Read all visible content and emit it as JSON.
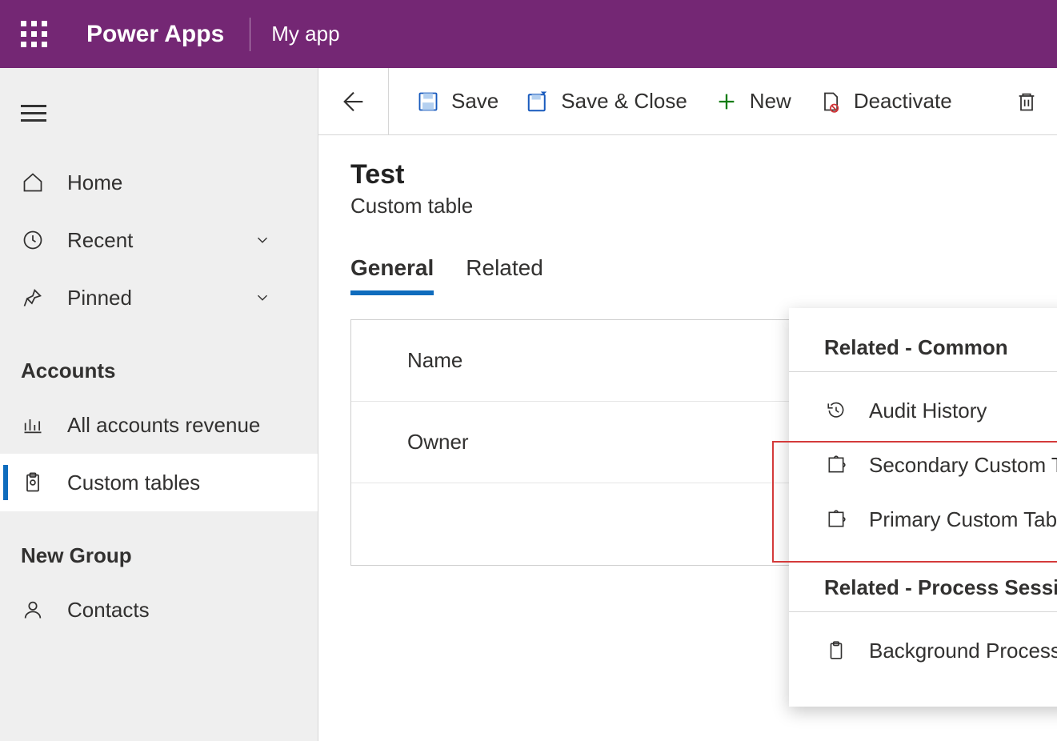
{
  "topbar": {
    "brand": "Power Apps",
    "app_name": "My app"
  },
  "sidebar": {
    "items": [
      {
        "label": "Home"
      },
      {
        "label": "Recent"
      },
      {
        "label": "Pinned"
      }
    ],
    "group1_title": "Accounts",
    "group1_items": [
      {
        "label": "All accounts revenue"
      },
      {
        "label": "Custom tables"
      }
    ],
    "group2_title": "New Group",
    "group2_items": [
      {
        "label": "Contacts"
      }
    ]
  },
  "commands": {
    "save": "Save",
    "save_close": "Save & Close",
    "new": "New",
    "deactivate": "Deactivate"
  },
  "record": {
    "title": "Test",
    "subtitle": "Custom table"
  },
  "tabs": {
    "general": "General",
    "related": "Related"
  },
  "form": {
    "name_label": "Name",
    "owner_label": "Owner"
  },
  "related_menu": {
    "section1_title": "Related - Common",
    "section1_items": [
      {
        "label": "Audit History"
      },
      {
        "label": "Secondary Custom Table Relationship"
      },
      {
        "label": "Primary Custom Table Relationship"
      }
    ],
    "section2_title": "Related - Process Sessions",
    "section2_items": [
      {
        "label": "Background Processes"
      }
    ]
  }
}
